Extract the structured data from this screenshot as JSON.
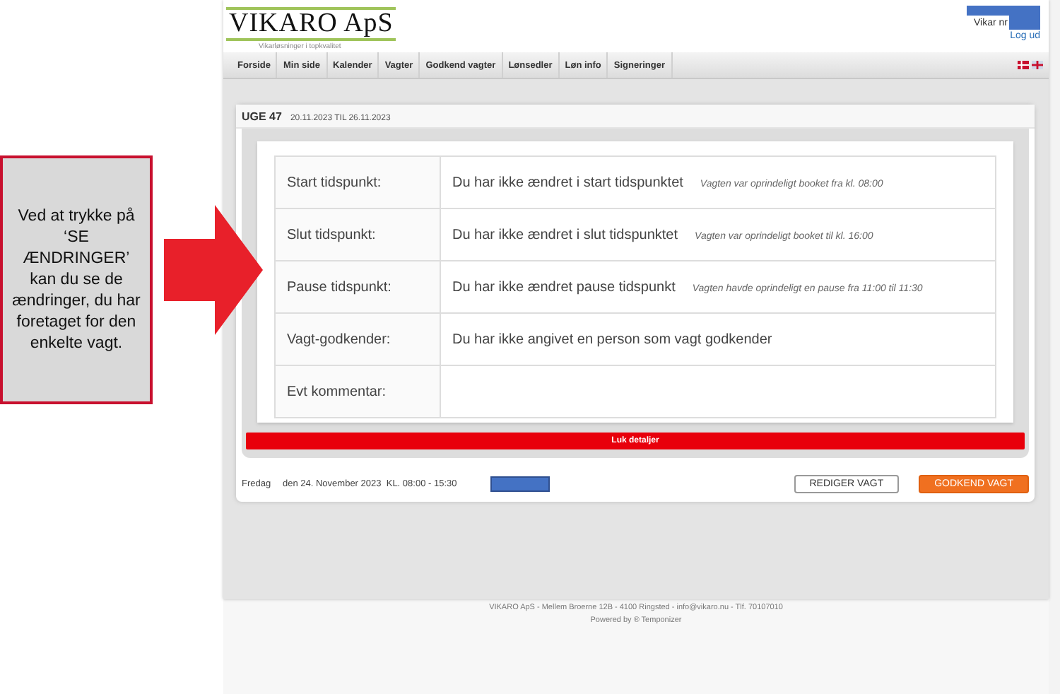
{
  "callout": {
    "text": "Ved at trykke på ‘SE ÆNDRINGER’ kan du se de ændringer, du har foretaget for den enkelte vagt."
  },
  "header": {
    "logo": "VIKARO ApS",
    "tagline": "Vikarløsninger i topkvalitet",
    "user_label": "Vikar nr",
    "logout": "Log ud"
  },
  "nav": [
    "Forside",
    "Min side",
    "Kalender",
    "Vagter",
    "Godkend vagter",
    "Lønsedler",
    "Løn info",
    "Signeringer"
  ],
  "week": {
    "title": "UGE 47",
    "range": "20.11.2023 TIL 26.11.2023"
  },
  "details": [
    {
      "label": "Start tidspunkt:",
      "value": "Du har ikke ændret i start tidspunktet",
      "note": "Vagten var oprindeligt booket fra kl. 08:00"
    },
    {
      "label": "Slut tidspunkt:",
      "value": "Du har ikke ændret i slut tidspunktet",
      "note": "Vagten var oprindeligt booket til kl. 16:00"
    },
    {
      "label": "Pause tidspunkt:",
      "value": "Du har ikke ændret pause tidspunkt",
      "note": "Vagten havde oprindeligt en pause fra 11:00 til 11:30"
    },
    {
      "label": "Vagt-godkender:",
      "value": "Du har ikke angivet en person som vagt godkender"
    },
    {
      "label": "Evt kommentar:"
    }
  ],
  "close_button": "Luk detaljer",
  "shift": {
    "day": "Fredag",
    "date": "den 24. November 2023  KL. 08:00 - 15:30",
    "buttons": [
      {
        "label": "REDIGER VAGT",
        "kind": "secondary"
      },
      {
        "label": "GODKEND VAGT",
        "kind": "primary"
      }
    ]
  },
  "footer": {
    "address": "VIKARO ApS - Mellem Broerne 12B - 4100 Ringsted - info@vikaro.nu - Tlf. 70107010",
    "powered": "Powered by ® Temponizer"
  }
}
